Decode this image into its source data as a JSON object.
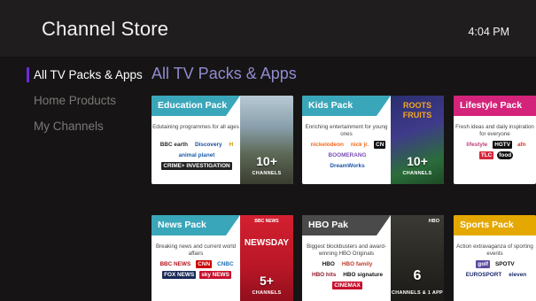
{
  "header": {
    "title": "Channel Store",
    "time": "4:04 PM"
  },
  "sidebar": {
    "items": [
      {
        "label": "All TV Packs & Apps",
        "active": true
      },
      {
        "label": "Home Products",
        "active": false
      },
      {
        "label": "My Channels",
        "active": false
      }
    ]
  },
  "main": {
    "section_title": "All TV Packs & Apps",
    "cards": [
      {
        "title": "Education Pack",
        "band_color": "#3aa6b9",
        "description": "Edutaining programmes for all ages",
        "logos": [
          "BBC earth",
          "Discovery",
          "H",
          "animal planet",
          "CRIME+ INVESTIGATION"
        ],
        "art_count": "10+",
        "art_label": "CHANNELS"
      },
      {
        "title": "Kids Pack",
        "band_color": "#3aa6b9",
        "description": "Enriching entertainment for young ones",
        "logos": [
          "nickelodeon",
          "nick jr.",
          "CN",
          "BOOMERANG",
          "DreamWorks"
        ],
        "art_title_line1": "ROOTS",
        "art_title_line2": "FRUITS",
        "art_count": "10+",
        "art_label": "CHANNELS"
      },
      {
        "title": "Lifestyle Pack",
        "band_color": "#d4237a",
        "description": "Fresh ideas and daily inspiration for everyone",
        "logos": [
          "lifestyle",
          "HGTV",
          "afn",
          "TLC",
          "food"
        ]
      },
      {
        "title": "News Pack",
        "band_color": "#3aa6b9",
        "description": "Breaking news and current world affairs",
        "logos": [
          "BBC NEWS",
          "CNN",
          "CNBC",
          "FOX NEWS",
          "sky NEWS"
        ],
        "art_head": "BBC NEWS",
        "art_title": "NEWSDAY",
        "art_count": "5+",
        "art_label": "CHANNELS"
      },
      {
        "title": "HBO Pak",
        "band_color": "#4a4a4a",
        "description": "Biggest blockbusters and award-winning HBO Originals",
        "logos": [
          "HBO",
          "HBO family",
          "HBO hits",
          "HBO signature",
          "CINEMAX"
        ],
        "art_head": "HBO",
        "art_count": "6",
        "art_label": "CHANNELS & 1 APP"
      },
      {
        "title": "Sports Pack",
        "band_color": "#e5a800",
        "description": "Action extravaganza of sporting events",
        "logos": [
          "golf",
          "SPOTV",
          "EUROSPORT",
          "eleven"
        ]
      }
    ]
  }
}
